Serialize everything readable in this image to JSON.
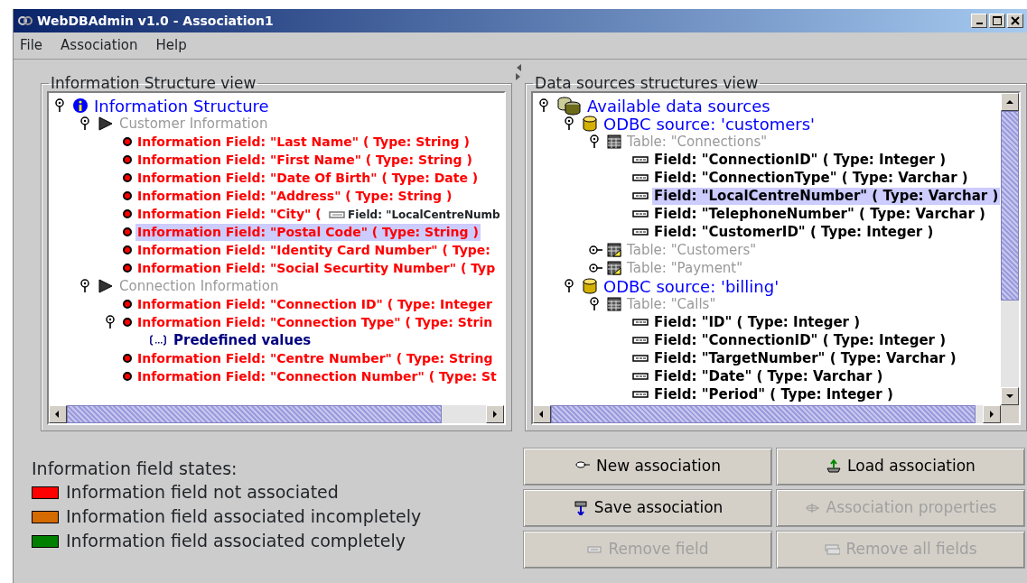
{
  "window": {
    "title": "WebDBAdmin v1.0 - Association1"
  },
  "menu": [
    {
      "label": "File"
    },
    {
      "label": "Association"
    },
    {
      "label": "Help"
    }
  ],
  "info_view": {
    "title": "Information Structure view",
    "tree": [
      {
        "kind": "root",
        "label": "Information Structure",
        "expanded": true,
        "selected": false,
        "children": [
          {
            "kind": "group",
            "label": "Customer Information",
            "expanded": true,
            "selected": false,
            "children": [
              {
                "kind": "field",
                "label": "Information Field: \"Last Name\" ( Type: String )",
                "color": "#ff0000",
                "selected": false
              },
              {
                "kind": "field",
                "label": "Information Field: \"First Name\" ( Type: String )",
                "color": "#ff0000",
                "selected": false
              },
              {
                "kind": "field",
                "label": "Information Field: \"Date Of Birth\" ( Type: Date )",
                "color": "#ff0000",
                "selected": false
              },
              {
                "kind": "field",
                "label": "Information Field: \"Address\" ( Type: String )",
                "color": "#ff0000",
                "selected": false
              },
              {
                "kind": "field",
                "label": "Information Field: \"City\" (",
                "color": "#ff0000",
                "selected": false
              },
              {
                "kind": "field",
                "label": "Information Field: \"Postal Code\" ( Type: String )",
                "color": "#ff0000",
                "selected": true
              },
              {
                "kind": "field",
                "label": "Information Field: \"Identity Card Number\" ( Type:",
                "color": "#ff0000",
                "selected": false
              },
              {
                "kind": "field",
                "label": "Information Field: \"Social Securtity Number\" ( Typ",
                "color": "#ff0000",
                "selected": false
              }
            ]
          },
          {
            "kind": "group",
            "label": "Connection Information",
            "expanded": true,
            "selected": false,
            "children": [
              {
                "kind": "field",
                "label": "Information Field: \"Connection ID\" ( Type: Integer",
                "color": "#ff0000",
                "selected": false
              },
              {
                "kind": "field",
                "label": "Information Field: \"Connection Type\" ( Type: Strin",
                "color": "#ff0000",
                "selected": false,
                "expanded": true,
                "children": [
                  {
                    "kind": "predefined",
                    "label": "Predefined values",
                    "selected": false
                  }
                ]
              },
              {
                "kind": "field",
                "label": "Information Field: \"Centre Number\" ( Type: String",
                "color": "#ff0000",
                "selected": false
              },
              {
                "kind": "field",
                "label": "Information Field: \"Connection Number\" ( Type: St",
                "color": "#ff0000",
                "selected": false
              }
            ]
          }
        ]
      }
    ],
    "drag_preview": "Field: \"LocalCentreNumb"
  },
  "sources_view": {
    "title": "Data sources structures view",
    "tree": [
      {
        "kind": "sources",
        "label": "Available data sources",
        "expanded": true,
        "selected": false,
        "children": [
          {
            "kind": "source",
            "label": "ODBC source: 'customers'",
            "expanded": true,
            "selected": false,
            "children": [
              {
                "kind": "table",
                "label": "Table: \"Connections\"",
                "expanded": true,
                "selected": false,
                "children": [
                  {
                    "kind": "column",
                    "label": "Field: \"ConnectionID\" ( Type: Integer )",
                    "selected": false
                  },
                  {
                    "kind": "column",
                    "label": "Field: \"ConnectionType\" ( Type: Varchar )",
                    "selected": false
                  },
                  {
                    "kind": "column",
                    "label": "Field: \"LocalCentreNumber\" ( Type: Varchar )",
                    "selected": true
                  },
                  {
                    "kind": "column",
                    "label": "Field: \"TelephoneNumber\" ( Type: Varchar )",
                    "selected": false
                  },
                  {
                    "kind": "column",
                    "label": "Field: \"CustomerID\" ( Type: Integer )",
                    "selected": false
                  }
                ]
              },
              {
                "kind": "table",
                "label": "Table: \"Customers\"",
                "expanded": false,
                "selected": false
              },
              {
                "kind": "table",
                "label": "Table: \"Payment\"",
                "expanded": false,
                "selected": false
              }
            ]
          },
          {
            "kind": "source",
            "label": "ODBC source: 'billing'",
            "expanded": true,
            "selected": false,
            "children": [
              {
                "kind": "table",
                "label": "Table: \"Calls\"",
                "expanded": true,
                "selected": false,
                "children": [
                  {
                    "kind": "column",
                    "label": "Field: \"ID\" ( Type: Integer )",
                    "selected": false
                  },
                  {
                    "kind": "column",
                    "label": "Field: \"ConnectionID\" ( Type: Integer )",
                    "selected": false
                  },
                  {
                    "kind": "column",
                    "label": "Field: \"TargetNumber\" ( Type: Varchar )",
                    "selected": false
                  },
                  {
                    "kind": "column",
                    "label": "Field: \"Date\" ( Type: Varchar )",
                    "selected": false
                  },
                  {
                    "kind": "column",
                    "label": "Field: \"Period\" ( Type: Integer )",
                    "selected": false
                  }
                ]
              }
            ]
          }
        ]
      }
    ]
  },
  "legend": {
    "title": "Information field states:",
    "items": [
      {
        "label": "Information field not associated",
        "color": "#ff0000"
      },
      {
        "label": "Information field associated incompletely",
        "color": "#d46a00"
      },
      {
        "label": "Information field associated completely",
        "color": "#008000"
      }
    ]
  },
  "buttons": [
    {
      "label": "New association",
      "kind": "new",
      "disabled": false
    },
    {
      "label": "Load association",
      "kind": "load",
      "disabled": false
    },
    {
      "label": "Save association",
      "kind": "save",
      "disabled": false
    },
    {
      "label": "Association properties",
      "kind": "properties",
      "disabled": true
    },
    {
      "label": "Remove field",
      "kind": "remove",
      "disabled": true
    },
    {
      "label": "Remove all fields",
      "kind": "remove_all",
      "disabled": true
    }
  ]
}
